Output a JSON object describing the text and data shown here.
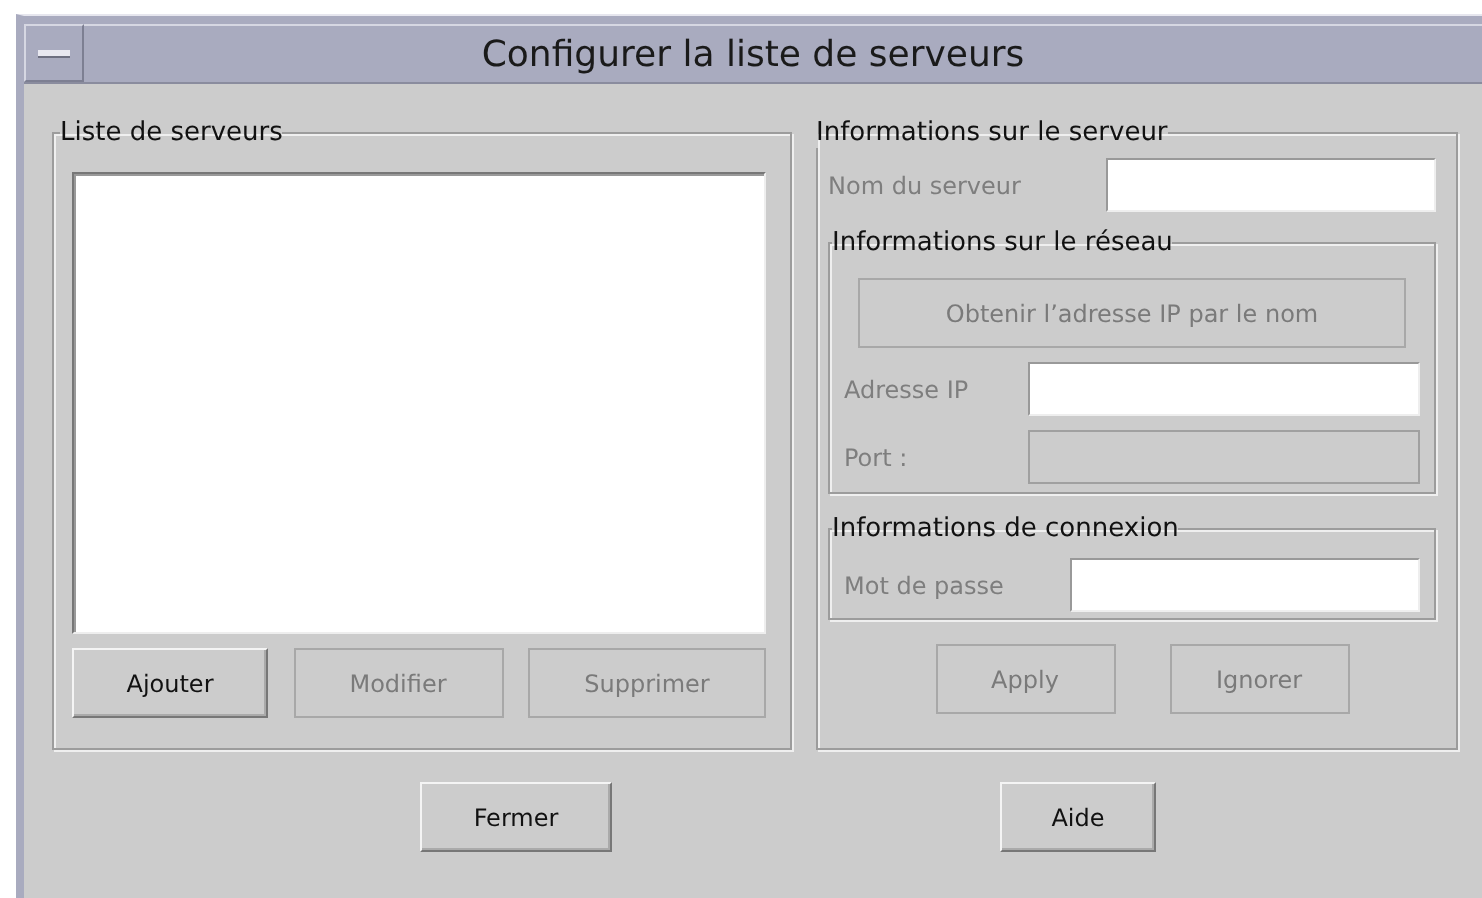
{
  "window": {
    "title": "Configurer la liste de serveurs"
  },
  "server_list": {
    "title": "Liste de serveurs",
    "buttons": [
      {
        "label": "Ajouter",
        "disabled": false
      },
      {
        "label": "Modifier",
        "disabled": true
      },
      {
        "label": "Supprimer",
        "disabled": true
      }
    ]
  },
  "server_info": {
    "title": "Informations sur le serveur",
    "name_field": {
      "label": "Nom du serveur",
      "label_greyed": true,
      "disabled": false
    },
    "network": {
      "title": "Informations sur le réseau",
      "lookup_button": {
        "label": "Obtenir l’adresse IP par le nom",
        "disabled": true
      },
      "fields": [
        {
          "label": "Adresse IP",
          "label_greyed": true,
          "disabled": false
        },
        {
          "label": "Port :",
          "label_greyed": true,
          "disabled": true
        }
      ]
    },
    "connection": {
      "title": "Informations de connexion",
      "fields": [
        {
          "label": "Mot de passe",
          "label_greyed": true,
          "disabled": false
        }
      ]
    },
    "buttons": [
      {
        "label": "Apply",
        "disabled": true
      },
      {
        "label": "Ignorer",
        "disabled": true
      }
    ]
  },
  "footer_buttons": [
    {
      "label": "Fermer",
      "disabled": false
    },
    {
      "label": "Aide",
      "disabled": false
    }
  ]
}
